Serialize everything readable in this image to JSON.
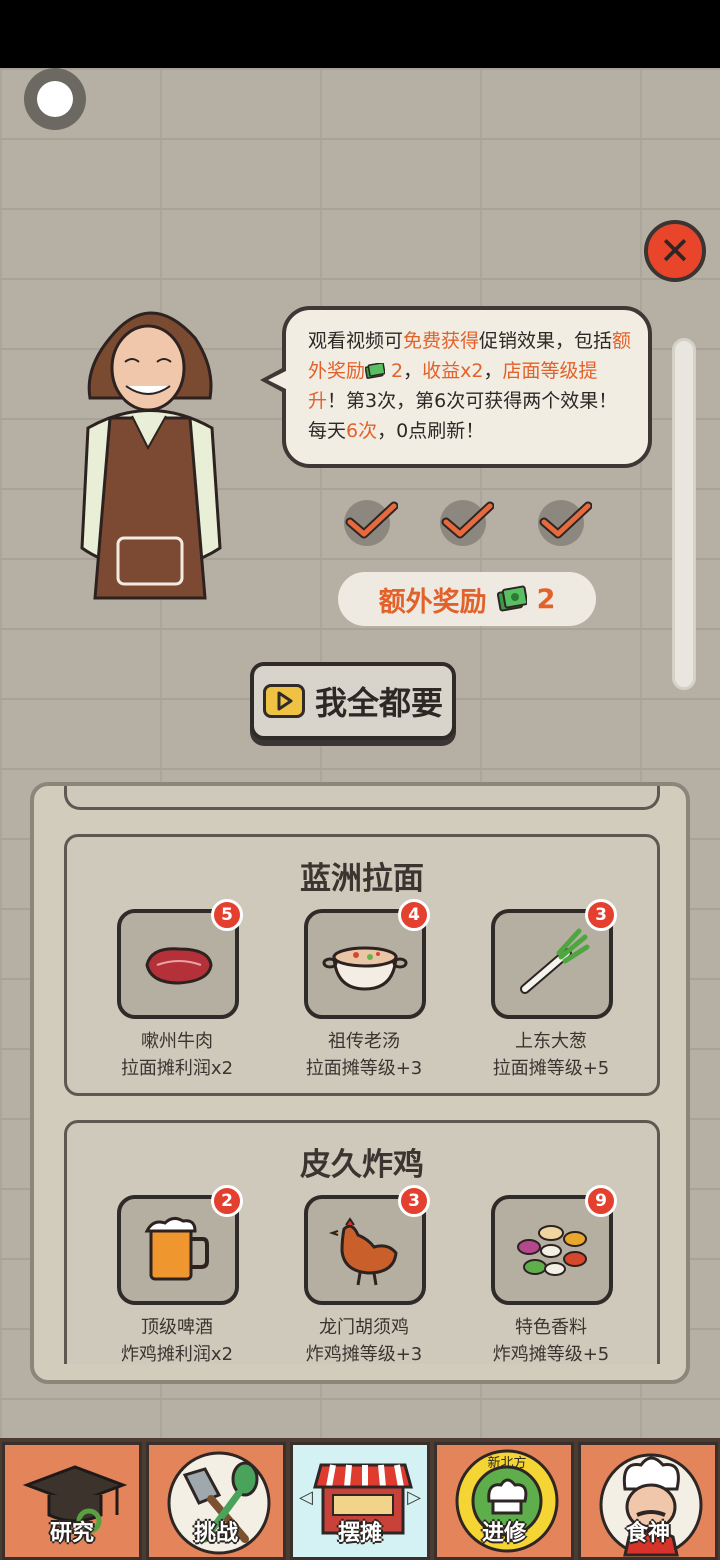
{
  "popup": {
    "message_parts": [
      {
        "text": "观看视频可",
        "hl": false
      },
      {
        "text": "免费获得",
        "hl": true
      },
      {
        "text": "促销效果，包括",
        "hl": false
      },
      {
        "text": "额外奖励",
        "hl": true
      },
      {
        "text": "__cash__",
        "hl": false
      },
      {
        "text": " 2",
        "hl": true
      },
      {
        "text": "，",
        "hl": false
      },
      {
        "text": "收益x2",
        "hl": true
      },
      {
        "text": "，",
        "hl": false
      },
      {
        "text": "店面等级提升",
        "hl": true
      },
      {
        "text": "！第3次，第6次可获得两个效果！每天",
        "hl": false
      },
      {
        "text": "6次",
        "hl": true
      },
      {
        "text": "，0点刷新！",
        "hl": false
      }
    ],
    "checks_completed": 3,
    "bonus_label": "额外奖励",
    "bonus_value": "2",
    "all_button_label": "我全都要"
  },
  "groups": [
    {
      "title": "蓝洲拉面",
      "items": [
        {
          "icon": "beef-icon",
          "name": "嗽州牛肉",
          "effect": "拉面摊利润x2",
          "badge": "5"
        },
        {
          "icon": "soup-bowl-icon",
          "name": "祖传老汤",
          "effect": "拉面摊等级+3",
          "badge": "4"
        },
        {
          "icon": "scallion-icon",
          "name": "上东大葱",
          "effect": "拉面摊等级+5",
          "badge": "3"
        }
      ]
    },
    {
      "title": "皮久炸鸡",
      "items": [
        {
          "icon": "beer-mug-icon",
          "name": "顶级啤酒",
          "effect": "炸鸡摊利润x2",
          "badge": "2"
        },
        {
          "icon": "chicken-icon",
          "name": "龙门胡须鸡",
          "effect": "炸鸡摊等级+3",
          "badge": "3"
        },
        {
          "icon": "spices-icon",
          "name": "特色香料",
          "effect": "炸鸡摊等级+5",
          "badge": "9"
        }
      ]
    }
  ],
  "tabs": [
    {
      "label": "研究",
      "icon": "graduation-cap-icon",
      "active": false
    },
    {
      "label": "挑战",
      "icon": "cooking-tools-icon",
      "active": false
    },
    {
      "label": "摆摊",
      "icon": "food-stall-icon",
      "active": true
    },
    {
      "label": "进修",
      "icon": "chef-badge-icon",
      "active": false,
      "badge_text": "新北方"
    },
    {
      "label": "食神",
      "icon": "chef-portrait-icon",
      "active": false
    }
  ],
  "colors": {
    "accent": "#e2622b",
    "badge": "#e4402f",
    "close": "#e8452b",
    "tab": "#e4845a",
    "tab_active": "#d4f2f4"
  }
}
